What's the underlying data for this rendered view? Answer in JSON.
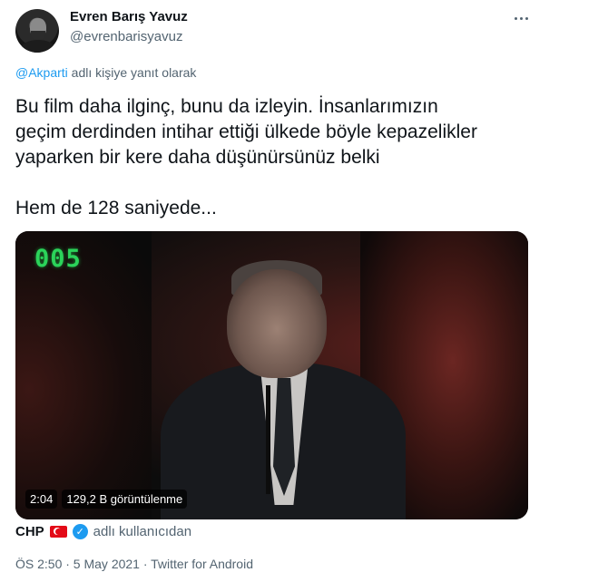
{
  "author": {
    "name": "Evren Barış Yavuz",
    "handle": "@evrenbarisyavuz"
  },
  "reply": {
    "mention": "@Akparti",
    "suffix": " adlı kişiye yanıt olarak"
  },
  "tweet": {
    "lines": [
      "Bu film daha ilginç, bunu da izleyin. İnsanlarımızın",
      "geçim derdinden intihar ettiği ülkede böyle kepazelikler",
      "yaparken bir kere daha düşünürsünüz belki"
    ],
    "last_line": "Hem de 128 saniyede..."
  },
  "video": {
    "counter": "005",
    "duration": "2:04",
    "views": "129,2 B görüntülenme"
  },
  "source": {
    "name": "CHP",
    "suffix": "adlı kullanıcıdan"
  },
  "meta": "ÖS 2:50 · 5 May 2021 · Twitter for Android",
  "colors": {
    "link": "#1d9bf0",
    "secondary_text": "#536471",
    "counter_green": "#2bd35a"
  }
}
